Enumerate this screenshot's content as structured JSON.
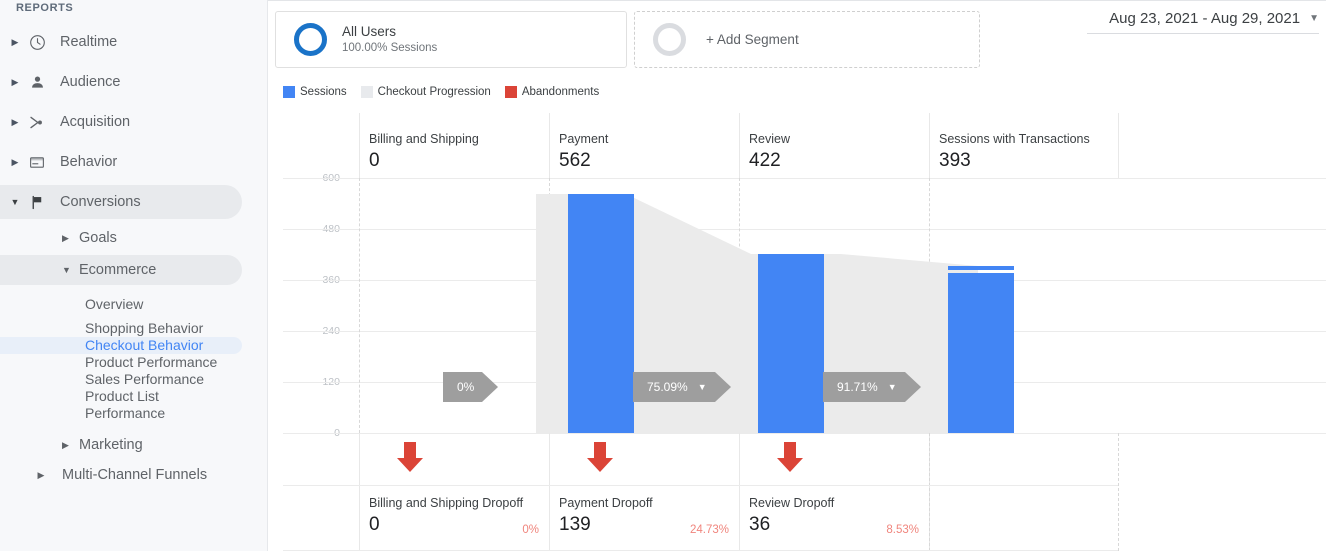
{
  "sidebar": {
    "section_label": "REPORTS",
    "top_items": [
      {
        "label": "Realtime",
        "icon": "clock-icon",
        "caret": "right"
      },
      {
        "label": "Audience",
        "icon": "person-icon",
        "caret": "right"
      },
      {
        "label": "Acquisition",
        "icon": "acquisition-icon",
        "caret": "right"
      },
      {
        "label": "Behavior",
        "icon": "behavior-icon",
        "caret": "right"
      },
      {
        "label": "Conversions",
        "icon": "flag-icon",
        "caret": "down"
      }
    ],
    "sub_items": [
      {
        "label": "Goals",
        "caret": "right"
      },
      {
        "label": "Ecommerce",
        "caret": "down"
      }
    ],
    "ecommerce_items": [
      "Overview",
      "Shopping Behavior",
      "Checkout Behavior",
      "Product Performance",
      "Sales Performance",
      "Product List Performance"
    ],
    "marketing": {
      "label": "Marketing",
      "caret": "right"
    },
    "multichannel": {
      "label": "Multi-Channel Funnels",
      "caret": "right"
    }
  },
  "segments": {
    "all_users": {
      "title": "All Users",
      "subtitle": "100.00% Sessions"
    },
    "add_segment": {
      "label": "+ Add Segment"
    }
  },
  "date_range": {
    "label": "Aug 23, 2021 - Aug 29, 2021",
    "caret": "▼"
  },
  "legend": [
    {
      "label": "Sessions",
      "color": "#4285f4"
    },
    {
      "label": "Checkout Progression",
      "color": "#e8eaed"
    },
    {
      "label": "Abandonments",
      "color": "#db4437"
    }
  ],
  "chart_data": {
    "type": "bar",
    "title": "Checkout Behavior Funnel",
    "categories": [
      "Billing and Shipping",
      "Payment",
      "Review",
      "Sessions with Transactions"
    ],
    "values": [
      0,
      562,
      422,
      393
    ],
    "ylabel": "",
    "xlabel": "",
    "ylim": [
      0,
      600
    ],
    "yticks": [
      0,
      120,
      240,
      360,
      480,
      600
    ],
    "grid": true,
    "legend_position": "top-left",
    "series": [
      {
        "name": "Sessions",
        "values": [
          0,
          562,
          422,
          393
        ],
        "color": "#4285f4"
      }
    ],
    "progression_rates": [
      {
        "label": "0%",
        "value": 0
      },
      {
        "label": "75.09%",
        "value": 75.09
      },
      {
        "label": "91.71%",
        "value": 91.71
      }
    ],
    "dropoffs": [
      {
        "label": "Billing and Shipping Dropoff",
        "value": "0",
        "percent": "0%"
      },
      {
        "label": "Payment Dropoff",
        "value": "139",
        "percent": "24.73%"
      },
      {
        "label": "Review Dropoff",
        "value": "36",
        "percent": "8.53%"
      }
    ]
  }
}
